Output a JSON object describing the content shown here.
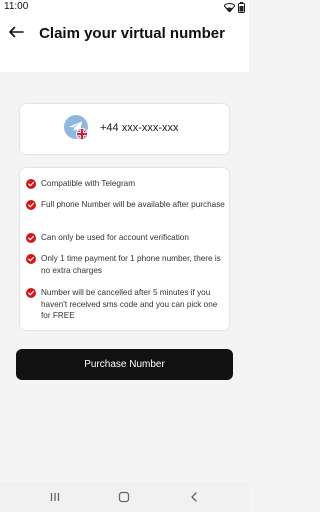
{
  "status_bar": {
    "time": "11:00"
  },
  "header": {
    "title": "Claim your virtual number"
  },
  "number_card": {
    "phone_number": "+44 xxx-xxx-xxx"
  },
  "features": [
    "Compatible with Telegram",
    "Full phone Number will be available after purchase",
    "Can only be used for account verification",
    "Only 1 time payment for 1 phone number, there is no extra charges",
    "Number will be cancelled after 5 minutes if you haven't received sms code and you can pick one for FREE"
  ],
  "purchase_button": {
    "label": "Purchase Number"
  },
  "colors": {
    "accent_red": "#d11a1a",
    "button_bg": "#111111",
    "telegram_blue": "#8fb8dc"
  },
  "icons": {
    "back": "arrow-left-icon",
    "check": "check-circle-icon",
    "telegram": "telegram-logo-icon",
    "flag": "uk-flag-icon"
  }
}
